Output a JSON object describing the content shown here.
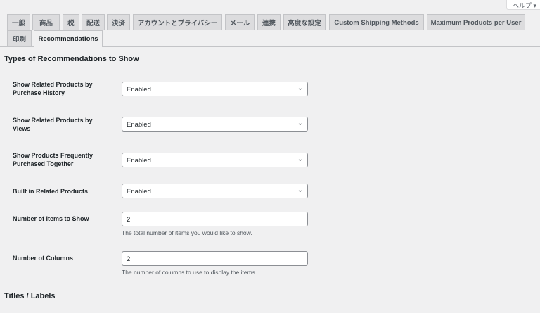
{
  "help_label": "ヘルプ ▾",
  "tabs_row1": [
    "一般",
    "商品",
    "税",
    "配送",
    "決済",
    "アカウントとプライバシー",
    "メール",
    "連携",
    "高度な設定",
    "Custom Shipping Methods",
    "Maximum Products per User"
  ],
  "tabs_row2": [
    "印刷",
    "Recommendations"
  ],
  "active_tab": "Recommendations",
  "section1_title": "Types of Recommendations to Show",
  "fields": [
    {
      "label": "Show Related Products by Purchase History",
      "type": "select",
      "value": "Enabled"
    },
    {
      "label": "Show Related Products by Views",
      "type": "select",
      "value": "Enabled"
    },
    {
      "label": "Show Products Frequently Purchased Together",
      "type": "select",
      "value": "Enabled"
    },
    {
      "label": "Built in Related Products",
      "type": "select",
      "value": "Enabled"
    },
    {
      "label": "Number of Items to Show",
      "type": "input",
      "value": "2",
      "description": "The total number of items you would like to show."
    },
    {
      "label": "Number of Columns",
      "type": "input",
      "value": "2",
      "description": "The number of columns to use to display the items."
    }
  ],
  "section2_title": "Titles / Labels"
}
